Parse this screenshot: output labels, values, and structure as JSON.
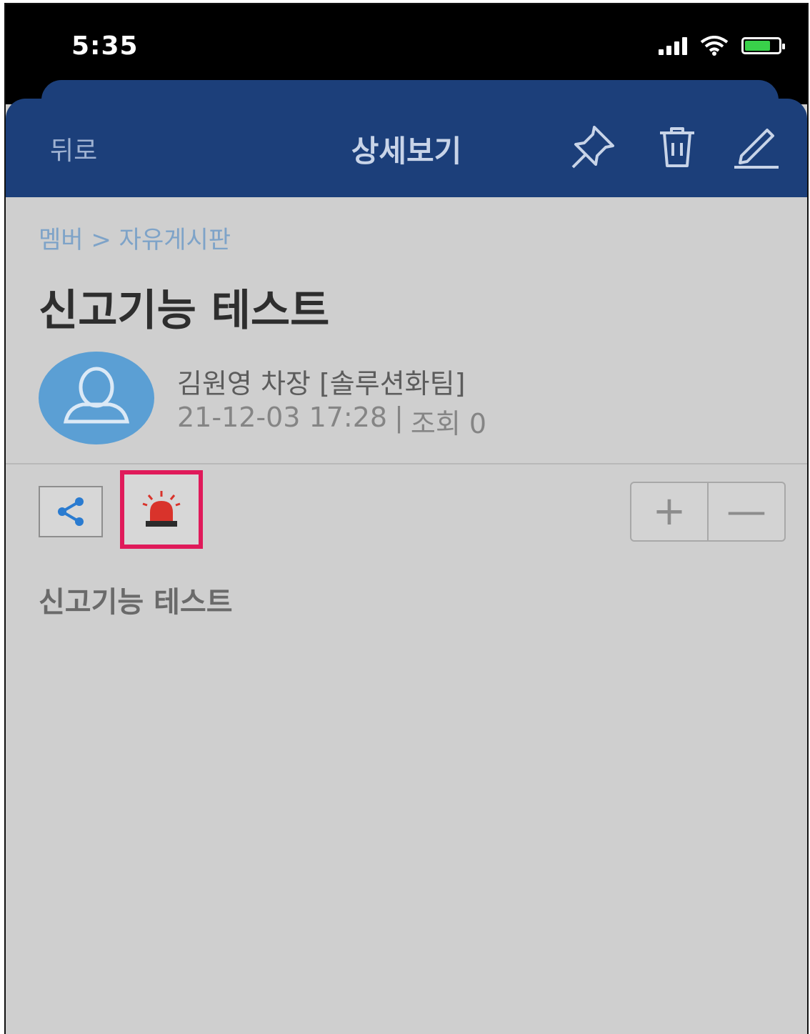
{
  "status_bar": {
    "time": "5:35",
    "battery_color": "#39d14a"
  },
  "header": {
    "back_label": "뒤로",
    "title": "상세보기",
    "bg_color": "#1c3f7a",
    "icons": [
      "pin-icon",
      "trash-icon",
      "edit-pencil-icon"
    ]
  },
  "post": {
    "breadcrumb": "멤버 > 자유게시판",
    "title": "신고기능 테스트",
    "author": "김원영 차장 [솔루션화팀]",
    "datetime": "21-12-03 17:28",
    "separator": "|",
    "views": "조회 0",
    "body": "신고기능 테스트"
  },
  "actions": {
    "icons": [
      "share-icon",
      "report-siren-icon"
    ],
    "highlight_color": "#e01a5a",
    "zoom_in_label": "+",
    "zoom_out_label": "—"
  }
}
